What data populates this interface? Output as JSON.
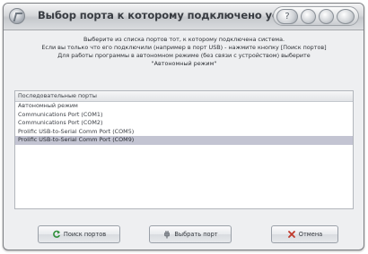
{
  "window": {
    "title": "Выбор порта к которому подключено устройство"
  },
  "description": [
    "Выберите из списка портов тот, к которому подключена система.",
    "Если вы только что его подключили (например в порт USB) - нажмите кнопку [Поиск портов]",
    "Для работы программы в автономном режиме (без связи с устройством) выберите",
    "\"Автономный режим\""
  ],
  "ports": {
    "header": "Последовательные порты",
    "items": [
      {
        "label": "Автономный режим",
        "selected": false
      },
      {
        "label": "Communications Port (COM1)",
        "selected": false
      },
      {
        "label": "Communications Port (COM2)",
        "selected": false
      },
      {
        "label": "Prolific USB-to-Serial Comm Port (COM5)",
        "selected": false
      },
      {
        "label": "Prolific USB-to-Serial Comm Port (COM9)",
        "selected": true
      }
    ]
  },
  "buttons": {
    "search": {
      "label": "Поиск портов",
      "icon": "refresh-icon"
    },
    "select": {
      "label": "Выбрать порт",
      "icon": "plug-icon"
    },
    "cancel": {
      "label": "Отмена",
      "icon": "close-icon"
    }
  },
  "colors": {
    "selection": "#c3c4d2",
    "refresh_icon": "#2f8f3a",
    "close_icon": "#c0392b"
  }
}
